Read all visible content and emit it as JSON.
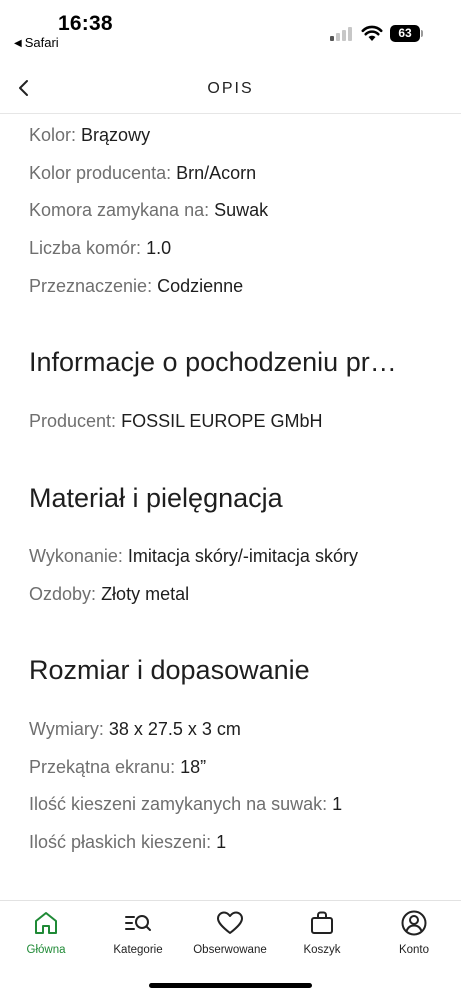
{
  "status_bar": {
    "time": "16:38",
    "back_app": "Safari",
    "battery": "63"
  },
  "header": {
    "title": "OPIS"
  },
  "details": [
    {
      "label": "Kolor:",
      "value": "Brązowy"
    },
    {
      "label": "Kolor producenta:",
      "value": "Brn/Acorn"
    },
    {
      "label": "Komora zamykana na:",
      "value": "Suwak"
    },
    {
      "label": "Liczba komór:",
      "value": "1.0"
    },
    {
      "label": "Przeznaczenie:",
      "value": "Codzienne"
    }
  ],
  "origin": {
    "title": "Informacje o pochodzeniu pr…",
    "rows": [
      {
        "label": "Producent:",
        "value": "FOSSIL EUROPE GMbH"
      }
    ]
  },
  "material": {
    "title": "Materiał i pielęgnacja",
    "rows": [
      {
        "label": "Wykonanie:",
        "value": "Imitacja skóry/-imitacja skóry"
      },
      {
        "label": "Ozdoby:",
        "value": "Złoty metal"
      }
    ]
  },
  "size": {
    "title": "Rozmiar i dopasowanie",
    "rows": [
      {
        "label": "Wymiary:",
        "value": "38 x 27.5 x 3 cm"
      },
      {
        "label": "Przekątna ekranu:",
        "value": "18”"
      },
      {
        "label": "Ilość kieszeni zamykanych na suwak:",
        "value": "1"
      },
      {
        "label": "Ilość płaskich kieszeni:",
        "value": "1"
      }
    ]
  },
  "bottom_nav": {
    "active_color": "#1f8a36",
    "items": [
      {
        "label": "Główna",
        "icon": "home-icon",
        "active": true
      },
      {
        "label": "Kategorie",
        "icon": "categories-search-icon",
        "active": false
      },
      {
        "label": "Obserwowane",
        "icon": "heart-icon",
        "active": false
      },
      {
        "label": "Koszyk",
        "icon": "cart-icon",
        "active": false
      },
      {
        "label": "Konto",
        "icon": "account-icon",
        "active": false
      }
    ]
  }
}
